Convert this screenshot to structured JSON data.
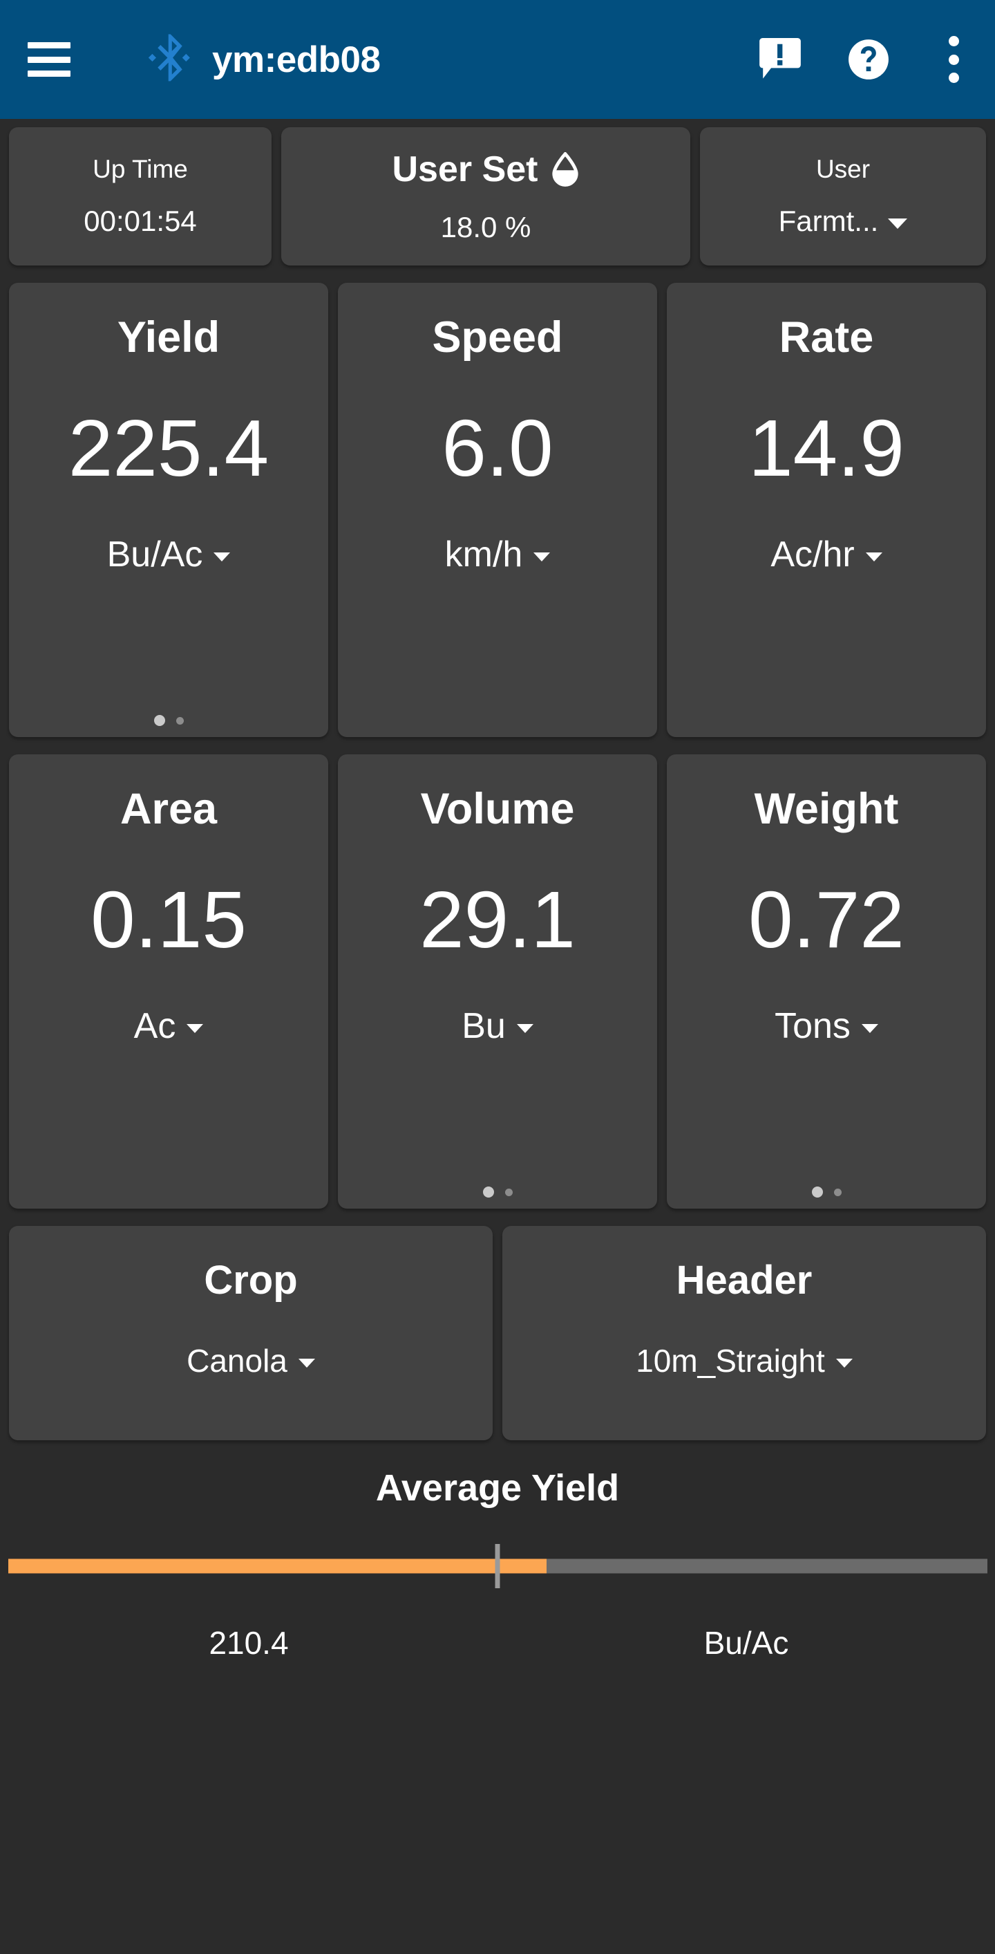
{
  "appbar": {
    "menu_icon": "hamburger-menu-icon",
    "bluetooth_icon": "bluetooth-icon",
    "title": "ym:edb08",
    "announcement_icon": "announcement-icon",
    "help_icon": "help-circle-icon",
    "overflow_icon": "more-vertical-icon",
    "background_color": "#024F7F",
    "bluetooth_color": "#2380CE"
  },
  "status": {
    "uptime": {
      "label": "Up Time",
      "value": "00:01:54"
    },
    "userset": {
      "label": "User Set",
      "icon": "water-drop-icon",
      "value": "18.0 %"
    },
    "user": {
      "label": "User",
      "value": "Farmt...",
      "caret": "chevron-down-icon"
    }
  },
  "metrics": [
    {
      "title": "Yield",
      "value": "225.4",
      "unit": "Bu/Ac",
      "pager": [
        true,
        false
      ]
    },
    {
      "title": "Speed",
      "value": "6.0",
      "unit": "km/h",
      "pager": []
    },
    {
      "title": "Rate",
      "value": "14.9",
      "unit": "Ac/hr",
      "pager": []
    },
    {
      "title": "Area",
      "value": "0.15",
      "unit": "Ac",
      "pager": []
    },
    {
      "title": "Volume",
      "value": "29.1",
      "unit": "Bu",
      "pager": [
        true,
        false
      ]
    },
    {
      "title": "Weight",
      "value": "0.72",
      "unit": "Tons",
      "pager": [
        true,
        false
      ]
    }
  ],
  "selectors": [
    {
      "title": "Crop",
      "value": "Canola"
    },
    {
      "title": "Header",
      "value": "10m_Straight"
    }
  ],
  "average_yield": {
    "title": "Average Yield",
    "value": "210.4",
    "unit": "Bu/Ac",
    "fill_percent": 55,
    "marker_percent": 50,
    "fill_color": "#FCA652",
    "track_color": "#6b6b6b",
    "marker_color": "#9a9a9a"
  },
  "theme": {
    "page_background": "#2b2b2b",
    "card_background": "#424242",
    "text_color": "#ffffff"
  }
}
